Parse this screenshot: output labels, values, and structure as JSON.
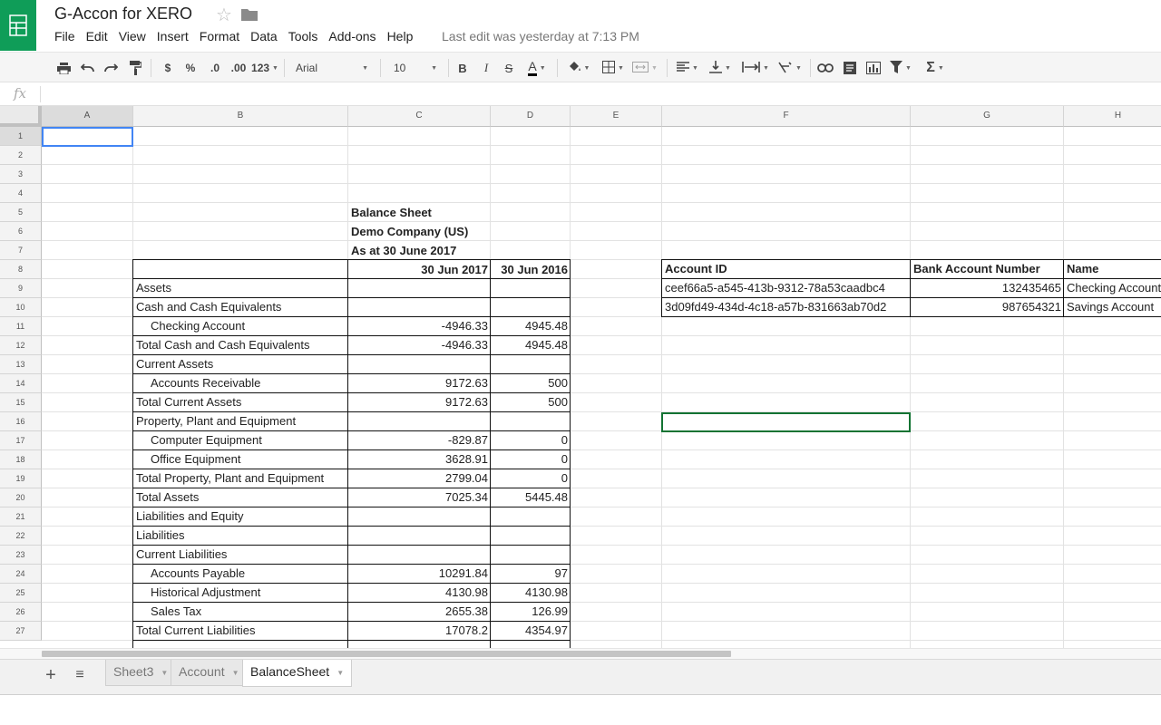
{
  "app": {
    "doc_title": "G-Accon for XERO",
    "last_edit": "Last edit was yesterday at 7:13 PM",
    "menus": [
      "File",
      "Edit",
      "View",
      "Insert",
      "Format",
      "Data",
      "Tools",
      "Add-ons",
      "Help"
    ]
  },
  "toolbar": {
    "currency": "$",
    "percent": "%",
    "decrease_decimals": ".0",
    "increase_decimals": ".00",
    "more_formats": "123",
    "font": "Arial",
    "font_size": "10",
    "bold": "B",
    "italic": "I",
    "strikethrough": "S",
    "text_color": "A",
    "functions": "Σ"
  },
  "formula_bar": {
    "fx": "fx",
    "value": ""
  },
  "columns": [
    "A",
    "B",
    "C",
    "D",
    "E",
    "F",
    "G",
    "H"
  ],
  "selected_column": "A",
  "rows": [
    "1",
    "2",
    "3",
    "4",
    "5",
    "6",
    "7",
    "8",
    "9",
    "10",
    "11",
    "12",
    "13",
    "14",
    "15",
    "16",
    "17",
    "18",
    "19",
    "20",
    "21",
    "22",
    "23",
    "24",
    "25",
    "26",
    "27"
  ],
  "selected_row": "1",
  "balance_sheet": {
    "title": "Balance Sheet",
    "company": "Demo Company (US)",
    "date": "As at 30 June 2017",
    "col_2017": "30 Jun 2017",
    "col_2016": "30 Jun 2016",
    "lines": [
      {
        "label": "Assets",
        "indent": false,
        "v2017": "",
        "v2016": ""
      },
      {
        "label": "Cash and Cash Equivalents",
        "indent": false,
        "v2017": "",
        "v2016": ""
      },
      {
        "label": "Checking Account",
        "indent": true,
        "v2017": "-4946.33",
        "v2016": "4945.48"
      },
      {
        "label": "Total Cash and Cash Equivalents",
        "indent": false,
        "v2017": "-4946.33",
        "v2016": "4945.48"
      },
      {
        "label": "Current Assets",
        "indent": false,
        "v2017": "",
        "v2016": ""
      },
      {
        "label": "Accounts Receivable",
        "indent": true,
        "v2017": "9172.63",
        "v2016": "500"
      },
      {
        "label": "Total Current Assets",
        "indent": false,
        "v2017": "9172.63",
        "v2016": "500"
      },
      {
        "label": "Property, Plant and Equipment",
        "indent": false,
        "v2017": "",
        "v2016": ""
      },
      {
        "label": "Computer Equipment",
        "indent": true,
        "v2017": "-829.87",
        "v2016": "0"
      },
      {
        "label": "Office Equipment",
        "indent": true,
        "v2017": "3628.91",
        "v2016": "0"
      },
      {
        "label": "Total Property, Plant and Equipment",
        "indent": false,
        "v2017": "2799.04",
        "v2016": "0"
      },
      {
        "label": "Total Assets",
        "indent": false,
        "v2017": "7025.34",
        "v2016": "5445.48"
      },
      {
        "label": "Liabilities and Equity",
        "indent": false,
        "v2017": "",
        "v2016": ""
      },
      {
        "label": "Liabilities",
        "indent": false,
        "v2017": "",
        "v2016": ""
      },
      {
        "label": "Current Liabilities",
        "indent": false,
        "v2017": "",
        "v2016": ""
      },
      {
        "label": "Accounts Payable",
        "indent": true,
        "v2017": "10291.84",
        "v2016": "97"
      },
      {
        "label": "Historical Adjustment",
        "indent": true,
        "v2017": "4130.98",
        "v2016": "4130.98"
      },
      {
        "label": "Sales Tax",
        "indent": true,
        "v2017": "2655.38",
        "v2016": "126.99"
      },
      {
        "label": "Total Current Liabilities",
        "indent": false,
        "v2017": "17078.2",
        "v2016": "4354.97"
      }
    ]
  },
  "accounts": {
    "headers": [
      "Account ID",
      "Bank Account Number",
      "Name"
    ],
    "rows": [
      [
        "ceef66a5-a545-413b-9312-78a53caadbc4",
        "132435465",
        "Checking Account"
      ],
      [
        "3d09fd49-434d-4c18-a57b-831663ab70d2",
        "987654321",
        "Savings Account"
      ]
    ]
  },
  "sheets": [
    {
      "name": "Sheet3",
      "active": false
    },
    {
      "name": "Account",
      "active": false
    },
    {
      "name": "BalanceSheet",
      "active": true
    }
  ],
  "colors": {
    "brand_green": "#0f9d58",
    "selection_blue": "#4285f4",
    "selection_green": "#137333"
  }
}
